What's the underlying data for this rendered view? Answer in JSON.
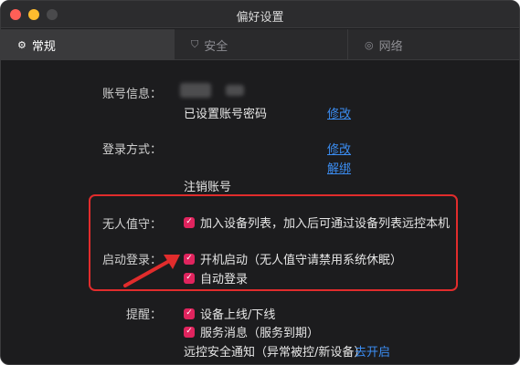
{
  "window": {
    "title": "偏好设置"
  },
  "tabs": [
    {
      "label": "常规",
      "icon": "gear-icon"
    },
    {
      "label": "安全",
      "icon": "shield-icon"
    },
    {
      "label": "网络",
      "icon": "globe-icon"
    }
  ],
  "account": {
    "label": "账号信息：",
    "password_status": "已设置账号密码",
    "modify": "修改"
  },
  "login_method": {
    "label": "登录方式：",
    "modify": "修改",
    "unbind": "解绑",
    "cancel_account": "注销账号"
  },
  "unattended": {
    "label": "无人值守：",
    "option": "加入设备列表，加入后可通过设备列表远控本机"
  },
  "startup": {
    "label": "启动登录：",
    "option_boot": "开机启动（无人值守请禁用系统休眠）",
    "option_autologin": "自动登录"
  },
  "reminders": {
    "label": "提醒：",
    "option_online": "设备上线/下线",
    "option_service": "服务消息（服务到期）",
    "security_notice": "远控安全通知（异常被控/新设备）",
    "enable_link": "去开启"
  },
  "colors": {
    "accent": "#e0245e",
    "link": "#3b8df2",
    "annotation": "#e12c2c"
  }
}
